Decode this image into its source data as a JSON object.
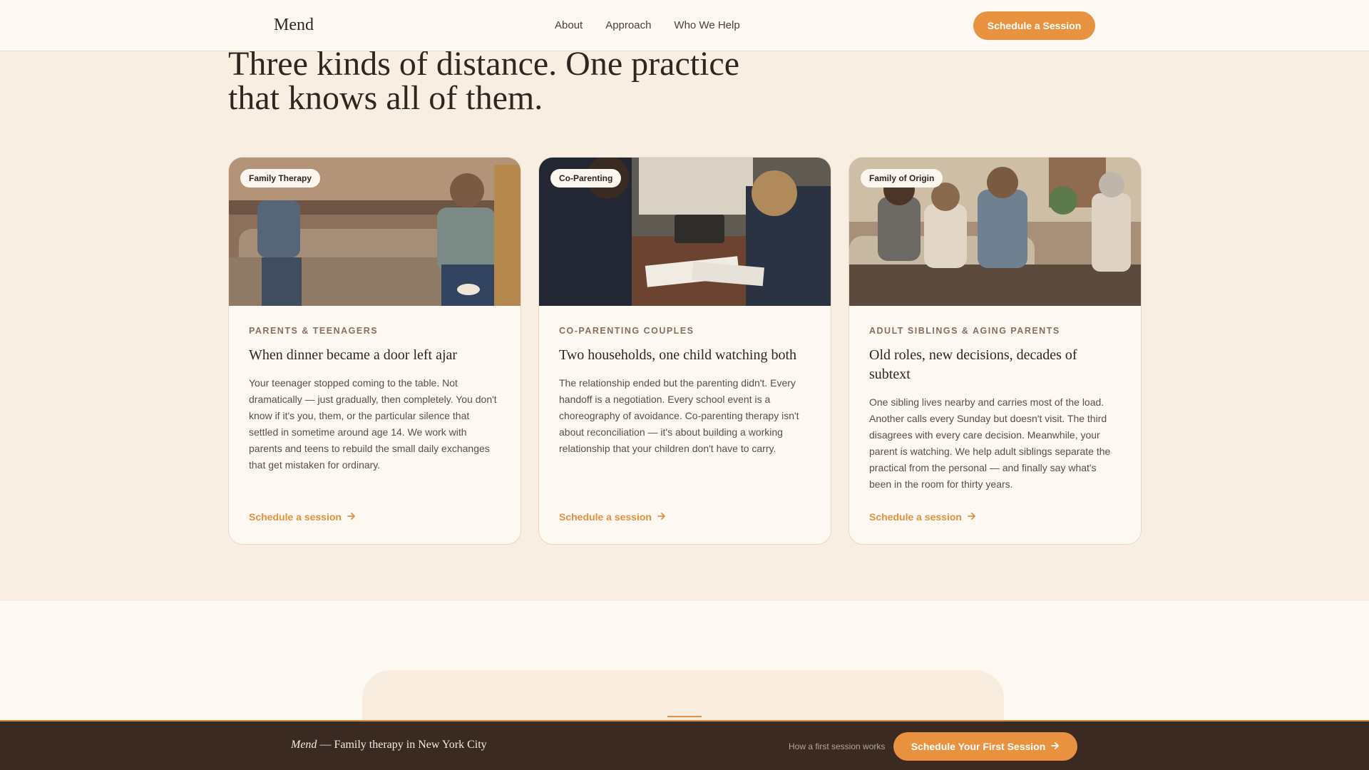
{
  "header": {
    "logo": "Mend",
    "nav": [
      "About",
      "Approach",
      "Who We Help"
    ],
    "cta": "Schedule a Session"
  },
  "main": {
    "heading": "Three kinds of distance. One practice that knows all of them.",
    "cards": [
      {
        "tag": "Family Therapy",
        "eyebrow": "PARENTS & TEENAGERS",
        "title": "When dinner became a door left ajar",
        "text": "Your teenager stopped coming to the table. Not dramatically — just gradually, then completely. You don't know if it's you, them, or the particular silence that settled in sometime around age 14. We work with parents and teens to rebuild the small daily exchanges that get mistaken for ordinary.",
        "link": "Schedule a session"
      },
      {
        "tag": "Co-Parenting",
        "eyebrow": "CO-PARENTING COUPLES",
        "title": "Two households, one child watching both",
        "text": "The relationship ended but the parenting didn't. Every handoff is a negotiation. Every school event is a choreography of avoidance. Co-parenting therapy isn't about reconciliation — it's about building a working relationship that your children don't have to carry.",
        "link": "Schedule a session"
      },
      {
        "tag": "Family of Origin",
        "eyebrow": "ADULT SIBLINGS & AGING PARENTS",
        "title": "Old roles, new decisions, decades of subtext",
        "text": "One sibling lives nearby and carries most of the load. Another calls every Sunday but doesn't visit. The third disagrees with every care decision. Meanwhile, your parent is watching. We help adult siblings separate the practical from the personal — and finally say what's been in the room for thirty years.",
        "link": "Schedule a session"
      }
    ]
  },
  "footer": {
    "brand_name": "Mend",
    "brand_tagline": "— Family therapy in New York City",
    "note": "How a first session works",
    "cta": "Schedule Your First Session"
  },
  "colors": {
    "accent": "#e8923f",
    "background": "#f8efe2",
    "footer": "#3a2a22"
  }
}
